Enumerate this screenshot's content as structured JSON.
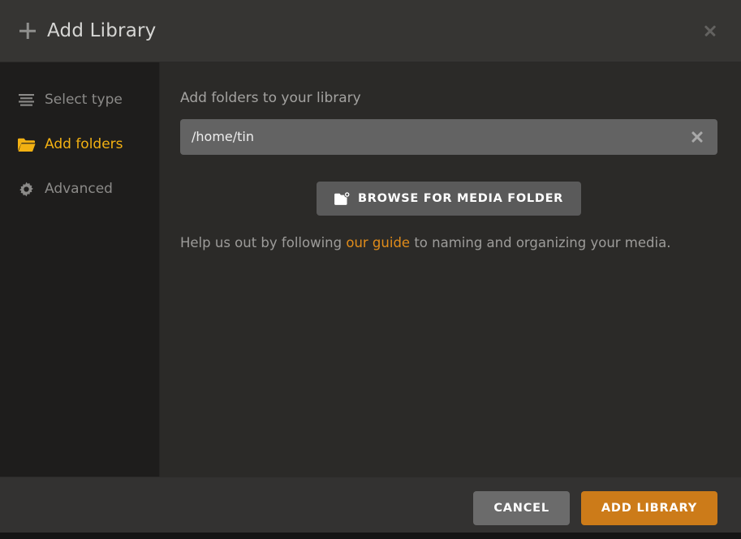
{
  "header": {
    "title": "Add Library",
    "plus_icon": "plus-icon",
    "close_icon": "close-icon"
  },
  "sidebar": {
    "items": [
      {
        "label": "Select type",
        "icon": "list-icon",
        "active": false
      },
      {
        "label": "Add folders",
        "icon": "folder-icon",
        "active": true
      },
      {
        "label": "Advanced",
        "icon": "gear-icon",
        "active": false
      }
    ]
  },
  "main": {
    "heading": "Add folders to your library",
    "folders": [
      {
        "path": "/home/tin",
        "remove_icon": "close-icon"
      }
    ],
    "browse_button": {
      "label": "BROWSE FOR MEDIA FOLDER",
      "icon": "folder-plus-icon"
    },
    "help": {
      "before": "Help us out by following ",
      "link": "our guide",
      "after": " to naming and organizing your media."
    }
  },
  "footer": {
    "cancel_label": "CANCEL",
    "submit_label": "ADD LIBRARY"
  },
  "colors": {
    "accent": "#cc7b19",
    "accent_text": "#f3b112",
    "link": "#e08c1a",
    "header_bg": "#363533",
    "sidebar_bg": "#1e1d1c",
    "content_bg": "#2b2a28",
    "footer_bg": "#333231",
    "input_bg": "#636363"
  }
}
